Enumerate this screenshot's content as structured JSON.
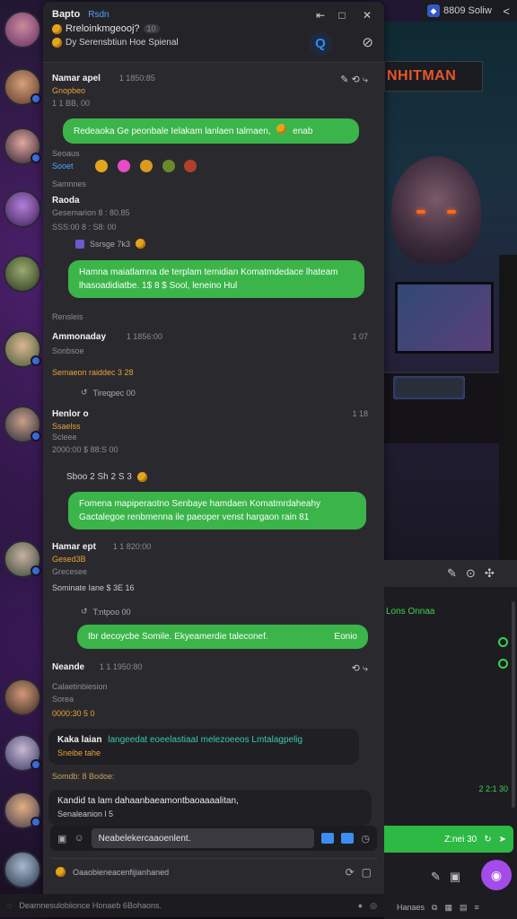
{
  "app": {
    "title": "Bapto",
    "title_sub": "Rsdn",
    "subtitle": "Rreloinkmgeooj?",
    "subtitle_badge": "10",
    "desc": "Dy Serensbtiun Hoe Spienal"
  },
  "topbar_right": {
    "label": "8809 Soliw"
  },
  "banner": {
    "text": "NHITMAN"
  },
  "messages": [
    {
      "name": "Namar apel",
      "time": "1 1850:85",
      "meta": "Gnopbeo",
      "meta2": "1 1 BB,  00"
    },
    {
      "bubble": "Redeaoka Ge peonbale Ielakam lanlaen talmaen,",
      "bubble_tail": "enab"
    },
    {
      "name": "Seoaus",
      "meta": "Sooet"
    },
    {
      "meta": "Samnnes"
    },
    {
      "name": "Raoda",
      "meta": "Gesemarion 8 : 80.85",
      "meta2": "SSS:00  8 :  S8:  00"
    },
    {
      "reply": "Ssrsge 7k3"
    },
    {
      "bubble": "Hamna maiatlamna de terplam temidian Komatmdedace lhateam lhasoadidiatbe. 1$ 8 $ Sool, leneino Hul"
    },
    {
      "meta": "Rensleis"
    },
    {
      "name": "Ammonaday",
      "time": "1 1856:00",
      "right": "1 07",
      "meta": "Sonbsoe"
    },
    {
      "orange": "Semaeon raiddec 3 28"
    },
    {
      "reply": "Tireqpec  00"
    },
    {
      "name": "Henlor o",
      "right": "1 18",
      "orange": "Ssaelss",
      "meta": "Scleee",
      "meta2": "2000:00  $ 88:S  00"
    },
    {
      "reply": "Sboo  2 Sh 2  S  3"
    },
    {
      "bubble": "Fomena mapiperaotno Senbaye hamdaen Komatmrdaheahy Gactalegoe renbmenna ile paeoper venst hargaon rain 81"
    },
    {
      "name": "Hamar ept",
      "time": "1 1  820:00",
      "orange": "Gesed3B",
      "meta": "Grecesee",
      "meta2": "Sominate Iane $ 3E  16"
    },
    {
      "reply": "T:ntpoo   00"
    },
    {
      "bubble": "Ibr decoycbe Somile. Ekyeamerdie taleconef.",
      "bubble_tail": "Eonio"
    },
    {
      "name": "Neande",
      "time": "1 1 1950:80",
      "meta": "Calaetinbiesion",
      "meta2": "Sorea"
    },
    {
      "orange": "0000:30  5 0"
    },
    {
      "name": "Kaka laian",
      "blue": "langeedat eoeelastiaaI melezoeeos Lmtalagpelig",
      "meta": "Sneibe tahe"
    },
    {
      "meta": "Somdb:  8 Bodoe:"
    },
    {
      "name": "Kandid ta lam dahaanbaeamontbaoaaaalitan,",
      "meta": "Senaleanion l 5"
    }
  ],
  "composer": {
    "value": "Neabelekercaaoenlent.",
    "hint": "Oaaobieneacenfijianhaned"
  },
  "footer": {
    "text": "Deamnesulobiionce Honaeb 6Bohaons."
  },
  "rpanel": {
    "greentxt": "Lons Onnaa",
    "timestamp": "2 2:1 30",
    "button_label": "Z:nei 30"
  },
  "rpanel_foot": {
    "label": "Hanaes"
  }
}
